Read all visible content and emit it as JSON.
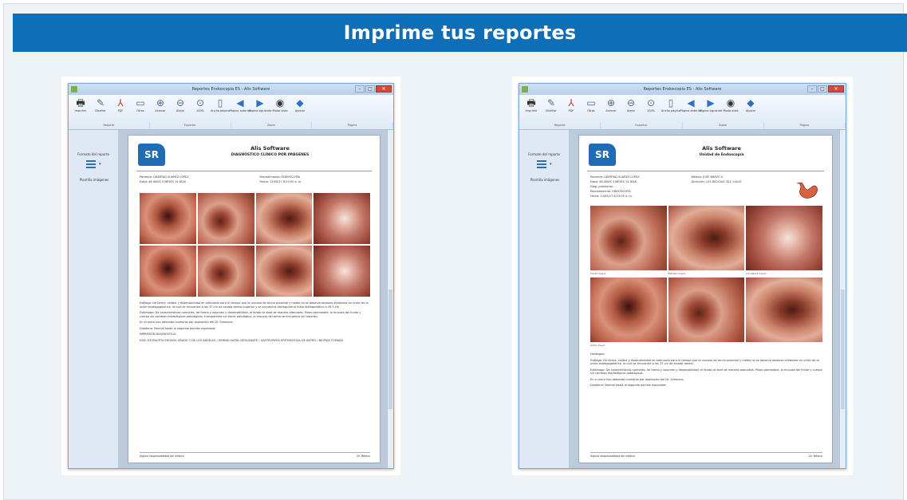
{
  "banner": {
    "title": "Imprime tus reportes"
  },
  "window": {
    "title": "Reportes Endoscopia ES - Alis Software",
    "controls": {
      "minimize": "–",
      "maximize": "□",
      "close": "✕"
    }
  },
  "ribbon": {
    "tools": [
      {
        "label": "Imprimir",
        "icon": "printer-icon",
        "glyph": "🖶",
        "color": "dark"
      },
      {
        "label": "Diseñar",
        "icon": "design-icon",
        "glyph": "✎",
        "color": ""
      },
      {
        "label": "PDF",
        "icon": "pdf-icon",
        "glyph": "⅄",
        "color": "red"
      },
      {
        "label": "Otros",
        "icon": "other-formats-icon",
        "glyph": "▭",
        "color": ""
      },
      {
        "label": "Acercar",
        "icon": "zoom-in-icon",
        "glyph": "⊕",
        "color": ""
      },
      {
        "label": "Alejar",
        "icon": "zoom-out-icon",
        "glyph": "⊖",
        "color": ""
      },
      {
        "label": "100%",
        "icon": "zoom-100-icon",
        "glyph": "⊙",
        "color": ""
      },
      {
        "label": "Ancho página",
        "icon": "page-width-icon",
        "glyph": "▯",
        "color": ""
      },
      {
        "label": "Página anterior",
        "icon": "previous-page-icon",
        "glyph": "◀",
        "color": "blue"
      },
      {
        "label": "Página siguiente",
        "icon": "next-page-icon",
        "glyph": "▶",
        "color": "blue"
      },
      {
        "label": "Modo vista",
        "icon": "view-mode-icon",
        "glyph": "◉",
        "color": "dark"
      },
      {
        "label": "Ajustar",
        "icon": "fit-icon",
        "glyph": "◆",
        "color": "blue"
      }
    ],
    "groups": [
      "Reporte",
      "Exportar",
      "Zoom",
      "Página"
    ]
  },
  "sidebar": {
    "title": "Formato del reporte",
    "item": "Plantilla imágenes"
  },
  "reports": [
    {
      "logo": "SR",
      "company": "Alis Software",
      "subtitle": "DIAGNÓSTICO CLÍNICO POR IMÁGENES",
      "patient": [
        "Paciente:  LIBERTAD SUAREZ LÓPEZ",
        "Procedimiento:  ENDOSCOPIA",
        "Edad:  46 AÑOS 3 MESES 14 DÍAS",
        "Fecha:  13/05/17 8:23:05 a. m."
      ],
      "captions": [],
      "text": [
        "Esófago: De forma, calibre y distensibilidad en adecuado para el tiempo que la mucosa de tercio proximal y medio no se observa lesiones evidentes en unión de la unión esofagogástrica, la cual se encuentra a los 37 cm de arcada dental superior y se encuentra distinguida al hiato diafragmático a 39.5 cm.",
        "Estómago: De características normales, de forma y volumen y distensibilidad, el fondo se abre de manera adecuada. Píloro permeable, la mucosa del fundo y cuerpo sin cambios morfológicos patológicos, transparente sin hacer patológico, la mucosa del antro se encuentra sin lesiones.",
        "En el antro han obtenido muestras por aspiración del Dr. Simmons.",
        "Duodeno: Normal hasta la segunda porción explorada.",
        "IMPRESIÓN DIAGNÓSTICA:",
        "EGD: ESOFAGITIS EROSIVA GRADO C DE LOS ANGELES / HERNIA HIATAL DESLIZANTE / GASTROPATÍA ERITEMATOSA DE ANTRO / BIOPSIA TOMADA"
      ],
      "footer_left": "Alguna responsabilidad del médico",
      "footer_right": "Dr. Médico"
    },
    {
      "logo": "SR",
      "company": "Alis Software",
      "subtitle": "Unidad de Endoscopía",
      "patient": [
        "Paciente:  LIBERTAD SUAREZ LÓPEZ",
        "Médico:  JOSE BRAVO S.",
        "Edad:  46 AÑOS 3 MESES 14 DÍAS",
        "Dirección:  LES DELICIAS 321, CALLE",
        "Diag. preliminar:  --",
        "",
        "Procedimiento:  ENDOSCOPIA",
        "",
        "Fecha:  13/05/17 8:23:05 a. m.",
        ""
      ],
      "captions": [
        "Fondo mayor",
        "Esfínter mayor",
        "Curvatura mayor",
        "Antro mayor",
        "",
        ""
      ],
      "text": [
        "Hallazgos:",
        "Esófago: De forma, calibre y distensibilidad en adecuado para el tiempo que la mucosa de tercio proximal y medio no se observa lesiones evidentes en unión de la unión esofagogástrica, la cual se encuentra a los 37 cm de arcada dental.",
        "Estómago: De características normales, de forma y volumen y distensibilidad, el fondo se abre de manera adecuada. Píloro permeable, la mucosa del fundo y cuerpo sin cambios morfológicos patológicos.",
        "En el antro han obtenido muestras por aspiración del Dr. Simmons.",
        "Duodeno: Normal hasta la segunda porción explorada."
      ],
      "footer_left": "Alguna responsabilidad del médico",
      "footer_right": "Dr. Médico"
    }
  ]
}
